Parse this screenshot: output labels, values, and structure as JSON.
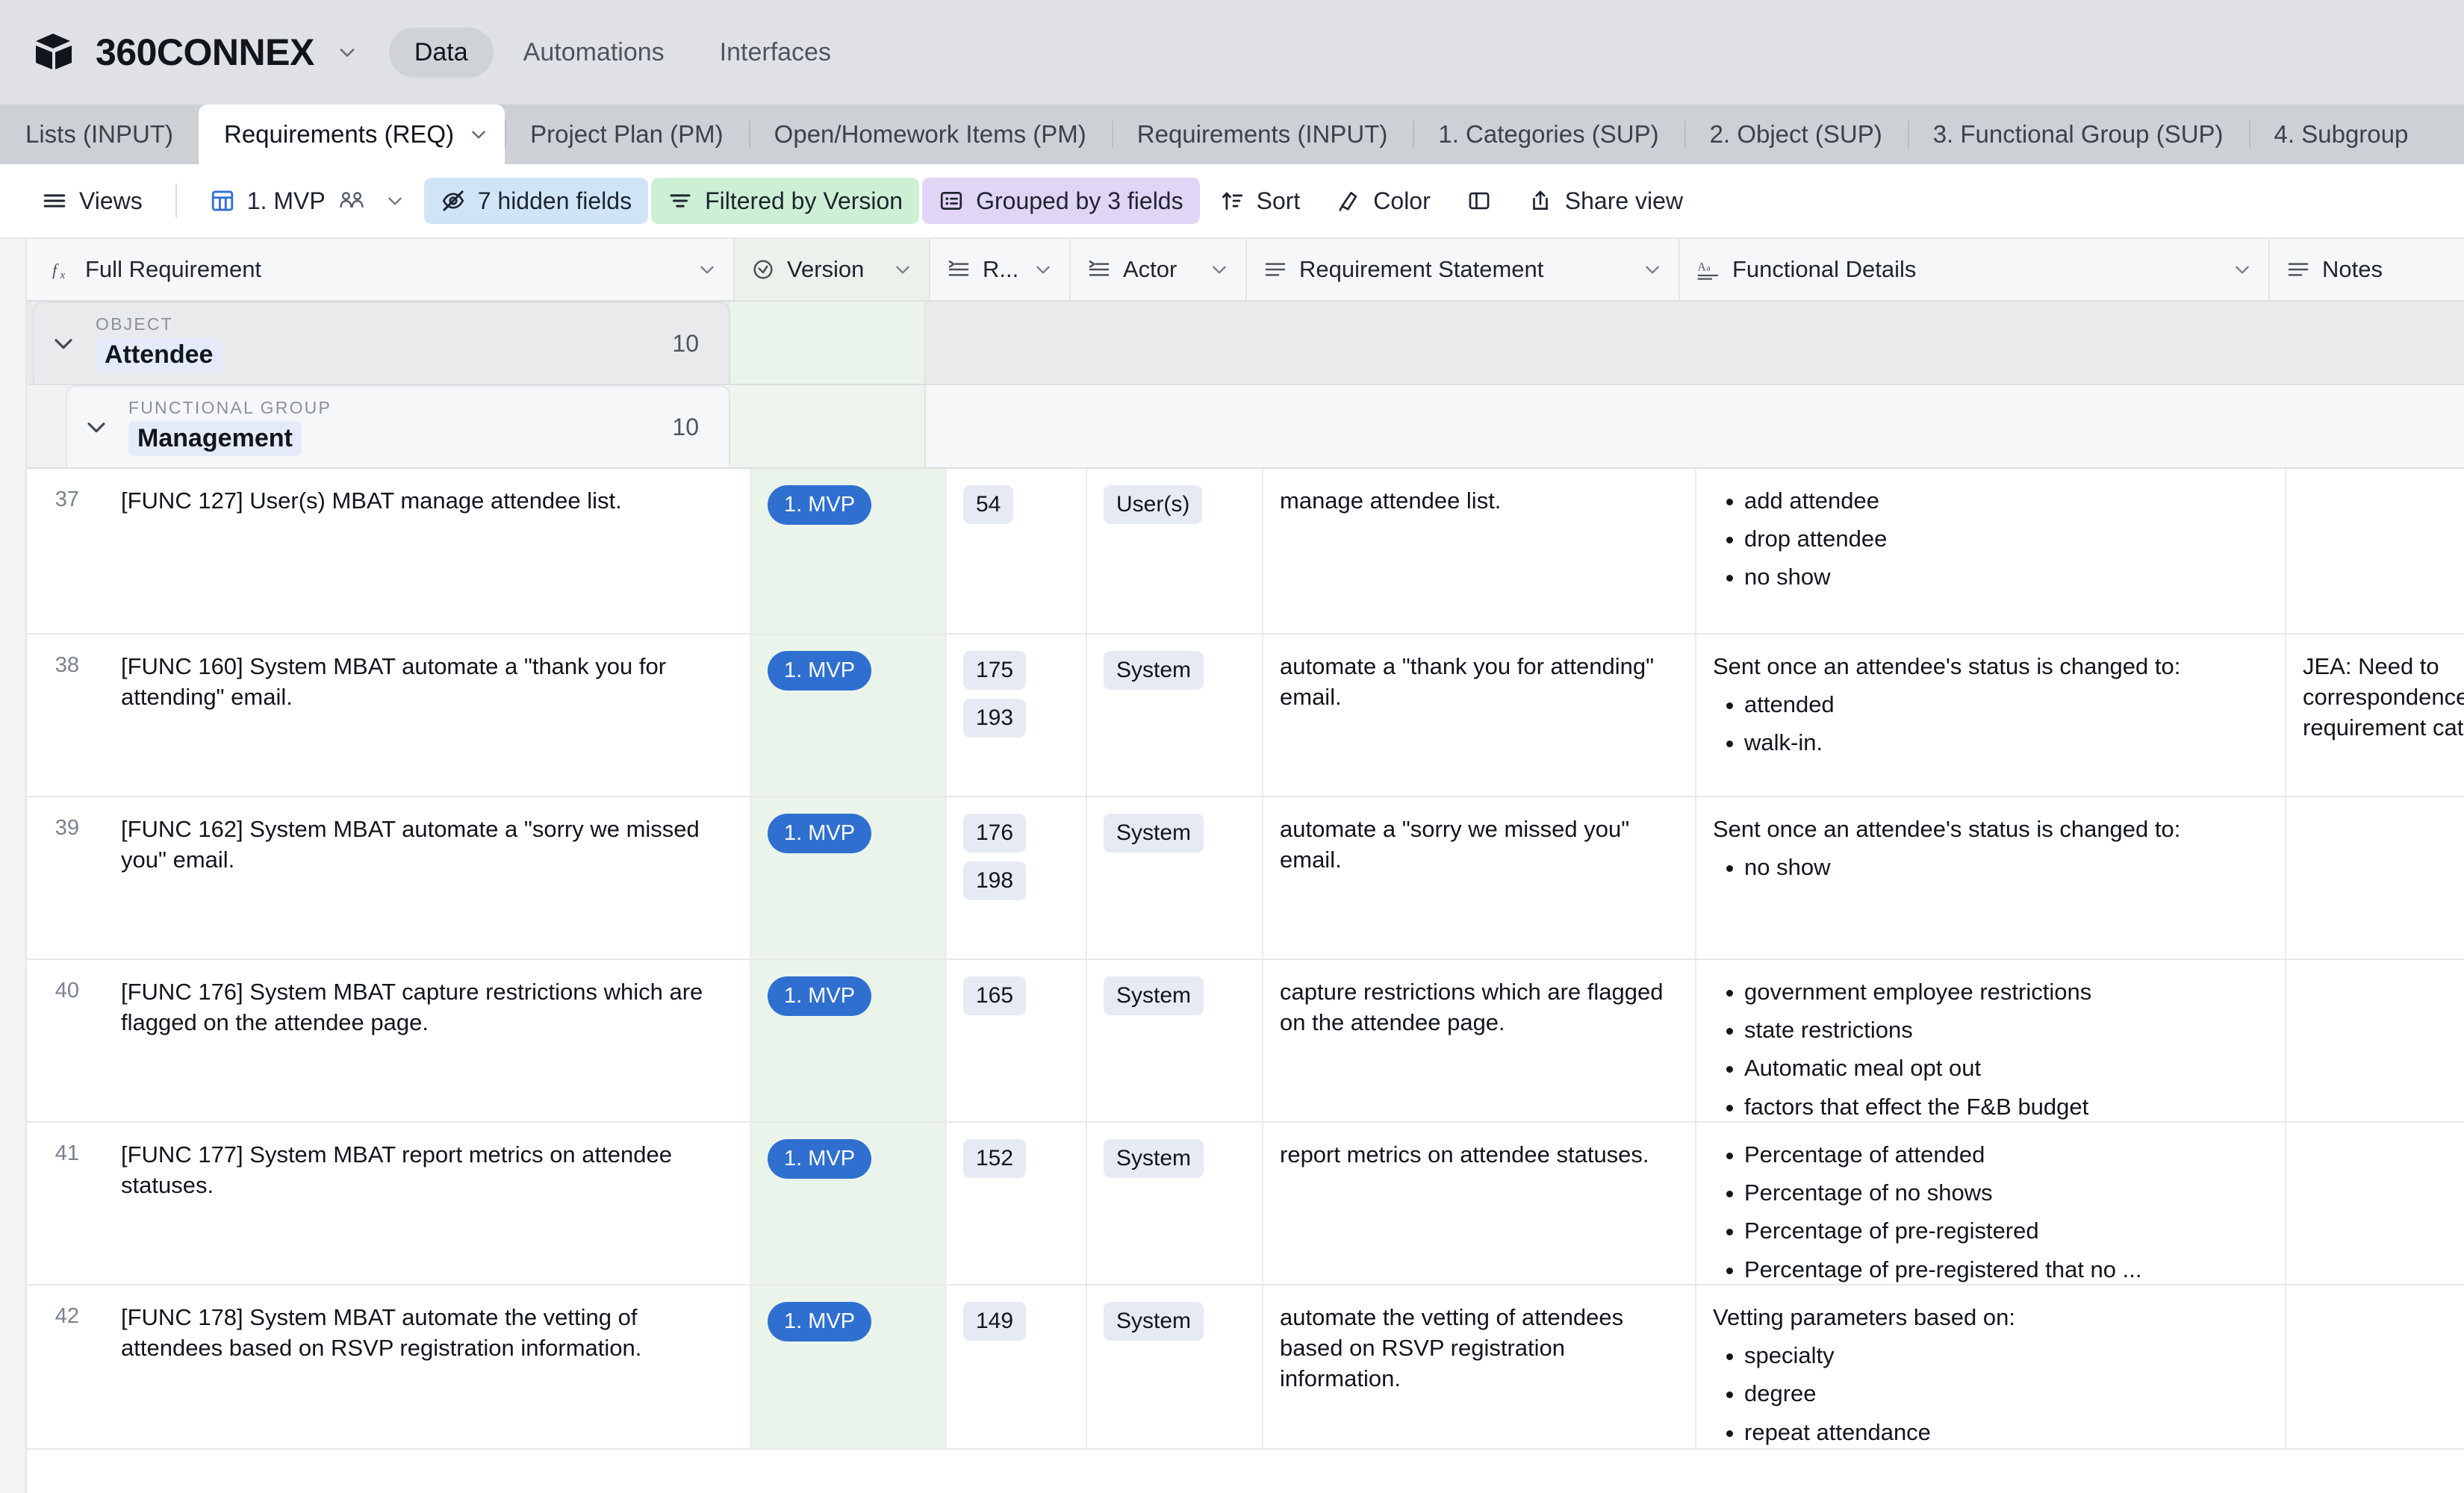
{
  "topbar": {
    "brand": "360CONNEX",
    "nav": [
      {
        "label": "Data",
        "active": true
      },
      {
        "label": "Automations",
        "active": false
      },
      {
        "label": "Interfaces",
        "active": false
      }
    ]
  },
  "tabs": [
    {
      "label": "Lists (INPUT)",
      "active": false
    },
    {
      "label": "Requirements (REQ)",
      "active": true
    },
    {
      "label": "Project Plan (PM)",
      "active": false
    },
    {
      "label": "Open/Homework Items (PM)",
      "active": false
    },
    {
      "label": "Requirements (INPUT)",
      "active": false
    },
    {
      "label": "1. Categories (SUP)",
      "active": false
    },
    {
      "label": "2. Object (SUP)",
      "active": false
    },
    {
      "label": "3. Functional Group (SUP)",
      "active": false
    },
    {
      "label": "4. Subgroup",
      "active": false
    }
  ],
  "toolbar": {
    "views_label": "Views",
    "view_name": "1. MVP",
    "hidden_fields_label": "7 hidden fields",
    "filter_label": "Filtered by Version",
    "group_label": "Grouped by 3 fields",
    "sort_label": "Sort",
    "color_label": "Color",
    "share_label": "Share view",
    "colors": {
      "hidden_chip": "#cfe5f7",
      "filter_chip": "#cdf0d4",
      "group_chip": "#e0d5f5",
      "version_pill": "#2f6fd0"
    }
  },
  "fields": [
    {
      "label": "Full Requirement",
      "icon": "formula-icon"
    },
    {
      "label": "Version",
      "icon": "single-select-icon"
    },
    {
      "label": "R...",
      "icon": "long-text-icon"
    },
    {
      "label": "Actor",
      "icon": "long-text-icon"
    },
    {
      "label": "Requirement Statement",
      "icon": "long-text-icon"
    },
    {
      "label": "Functional Details",
      "icon": "rich-text-icon"
    },
    {
      "label": "Notes",
      "icon": "long-text-icon"
    }
  ],
  "groups": [
    {
      "kicker": "OBJECT",
      "value": "Attendee",
      "count": "10"
    },
    {
      "kicker": "FUNCTIONAL GROUP",
      "value": "Management",
      "count": "10"
    }
  ],
  "rows": [
    {
      "num": "37",
      "full_requirement": "[FUNC 127] User(s) MBAT manage attendee list.",
      "version": "1. MVP",
      "r": [
        "54"
      ],
      "actor": [
        "User(s)"
      ],
      "statement": "manage attendee list.",
      "details_intro": "",
      "details_bullets": [
        "add attendee",
        "drop attendee",
        "no show"
      ],
      "notes": ""
    },
    {
      "num": "38",
      "full_requirement": "[FUNC 160] System MBAT automate a \"thank you for attending\" email.",
      "version": "1. MVP",
      "r": [
        "175",
        "193"
      ],
      "actor": [
        "System"
      ],
      "statement": "automate a \"thank you for attending\" email.",
      "details_intro": "Sent once an attendee's status is changed to:",
      "details_bullets": [
        "attended",
        "walk-in."
      ],
      "notes": "JEA: Need to correspondence requirement category.  Th"
    },
    {
      "num": "39",
      "full_requirement": "[FUNC 162] System MBAT automate a \"sorry we missed you\" email.",
      "version": "1. MVP",
      "r": [
        "176",
        "198"
      ],
      "actor": [
        "System"
      ],
      "statement": "automate a \"sorry we missed you\" email.",
      "details_intro": "Sent once an attendee's status is changed to:",
      "details_bullets": [
        "no show"
      ],
      "notes": ""
    },
    {
      "num": "40",
      "full_requirement": "[FUNC 176] System MBAT capture restrictions which are flagged on the attendee page.",
      "version": "1. MVP",
      "r": [
        "165"
      ],
      "actor": [
        "System"
      ],
      "statement": "capture restrictions which are flagged on the attendee page.",
      "details_intro": "",
      "details_bullets": [
        "government employee restrictions",
        "state restrictions",
        "Automatic meal opt out",
        "factors that effect the F&B budget"
      ],
      "notes": ""
    },
    {
      "num": "41",
      "full_requirement": "[FUNC 177] System MBAT report metrics on attendee statuses.",
      "version": "1. MVP",
      "r": [
        "152"
      ],
      "actor": [
        "System"
      ],
      "statement": "report metrics on attendee statuses.",
      "details_intro": "",
      "details_bullets": [
        "Percentage of attended",
        "Percentage of no shows",
        "Percentage of pre-registered",
        "Percentage of pre-registered that no ..."
      ],
      "notes": ""
    },
    {
      "num": "42",
      "full_requirement": "[FUNC 178] System MBAT automate the vetting of attendees based on RSVP registration information.",
      "version": "1. MVP",
      "r": [
        "149"
      ],
      "actor": [
        "System"
      ],
      "statement": "automate the vetting of attendees based on RSVP registration information.",
      "details_intro": "Vetting parameters based on:",
      "details_bullets": [
        "specialty",
        "degree",
        "repeat attendance"
      ],
      "notes": ""
    }
  ]
}
